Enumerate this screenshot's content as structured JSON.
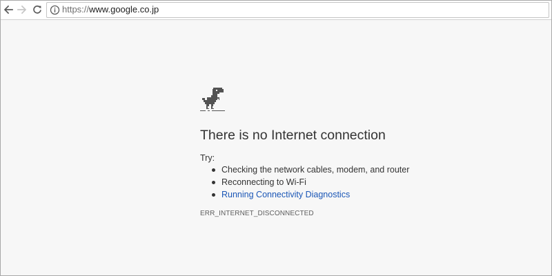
{
  "toolbar": {
    "back_icon": "arrow-left-icon",
    "forward_icon": "arrow-right-icon",
    "reload_icon": "reload-icon",
    "info_icon": "info-circle-icon"
  },
  "omnibox": {
    "url_scheme": "https://",
    "url_host": "www.google.co.jp"
  },
  "error_page": {
    "icon": "offline-dinosaur-icon",
    "heading": "There is no Internet connection",
    "try_label": "Try:",
    "suggestions": [
      {
        "text": "Checking the network cables, modem, and router",
        "is_link": false
      },
      {
        "text": "Reconnecting to Wi-Fi",
        "is_link": false
      },
      {
        "text": "Running Connectivity Diagnostics",
        "is_link": true
      }
    ],
    "error_code": "ERR_INTERNET_DISCONNECTED"
  },
  "colors": {
    "page_background": "#f7f7f7",
    "text": "#333333",
    "link": "#1a56b6",
    "error_code": "#5e5e5e"
  }
}
